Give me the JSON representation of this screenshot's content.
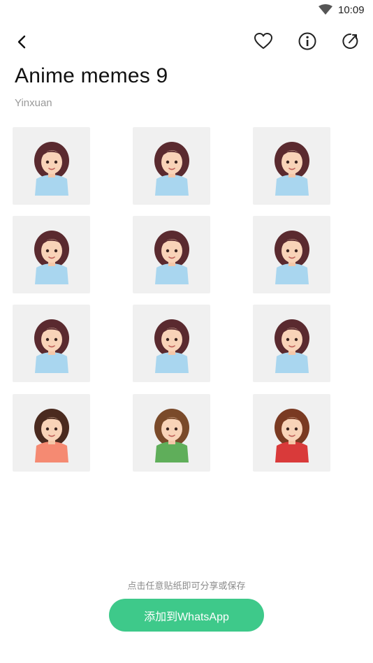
{
  "status_bar": {
    "time": "10:09",
    "wifi_icon": "wifi-icon"
  },
  "toolbar": {
    "back_icon": "back-arrow-icon",
    "favorite_icon": "heart-icon",
    "info_icon": "info-icon",
    "share_icon": "share-icon"
  },
  "pack": {
    "title": "Anime memes 9",
    "author": "Yinxuan"
  },
  "stickers": [
    {
      "label": "sticker-1",
      "pose": "hands-on-cheeks",
      "hair": "#5a2a2f",
      "top": "#a9d6ef"
    },
    {
      "label": "sticker-2",
      "pose": "finger-chin",
      "hair": "#5a2a2f",
      "top": "#a9d6ef"
    },
    {
      "label": "sticker-3",
      "pose": "chin-rest",
      "hair": "#5a2a2f",
      "top": "#a9d6ef"
    },
    {
      "label": "sticker-4",
      "pose": "wink-thumbs",
      "hair": "#5a2a2f",
      "top": "#a9d6ef"
    },
    {
      "label": "sticker-5",
      "pose": "peace-signs",
      "hair": "#5a2a2f",
      "top": "#a9d6ef"
    },
    {
      "label": "sticker-6",
      "pose": "surprised",
      "hair": "#5a2a2f",
      "top": "#a9d6ef"
    },
    {
      "label": "sticker-7",
      "pose": "neutral",
      "hair": "#5a2a2f",
      "top": "#a9d6ef"
    },
    {
      "label": "sticker-8",
      "pose": "headache",
      "hair": "#5a2a2f",
      "top": "#a9d6ef"
    },
    {
      "label": "sticker-9",
      "pose": "sad",
      "hair": "#5a2a2f",
      "top": "#a9d6ef"
    },
    {
      "label": "sticker-10",
      "pose": "thinking",
      "hair": "#4a2a1f",
      "top": "#f58a72"
    },
    {
      "label": "sticker-11",
      "pose": "side-flower",
      "hair": "#7a4a2a",
      "top": "#5fae5a"
    },
    {
      "label": "sticker-12",
      "pose": "arms-crossed",
      "hair": "#7a3a22",
      "top": "#d93a3a"
    }
  ],
  "footer": {
    "hint": "点击任意贴纸即可分享或保存",
    "button_label": "添加到WhatsApp"
  },
  "colors": {
    "accent": "#3ec98a",
    "tile_bg": "#f0f0f0",
    "muted_text": "#999999"
  }
}
